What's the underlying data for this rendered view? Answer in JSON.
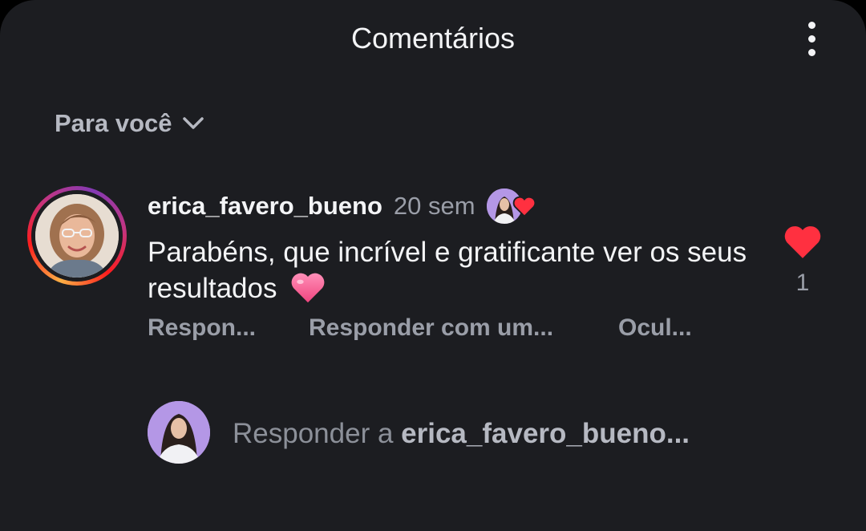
{
  "header": {
    "title": "Comentários",
    "more_icon": "more-vertical-icon"
  },
  "filter": {
    "label": "Para você",
    "icon": "chevron-down-icon"
  },
  "comment": {
    "username": "erica_favero_bueno",
    "time": "20 sem",
    "text": "Parabéns, que incrível e gratificante ver os seus resultados",
    "emoji": "pink-heart-icon",
    "liked_by_author": true,
    "like_count": "1",
    "liked": true,
    "actions": {
      "reply": "Respon...",
      "reply_with_sticker": "Responder com um...",
      "hide": "Ocul..."
    }
  },
  "reply_bar": {
    "prefix": "Responder a",
    "target": "erica_favero_bueno..."
  },
  "colors": {
    "background": "#1c1d21",
    "primary_text": "#f3f4f6",
    "secondary_text": "#9a9ea8",
    "like_red": "#ff3040"
  }
}
